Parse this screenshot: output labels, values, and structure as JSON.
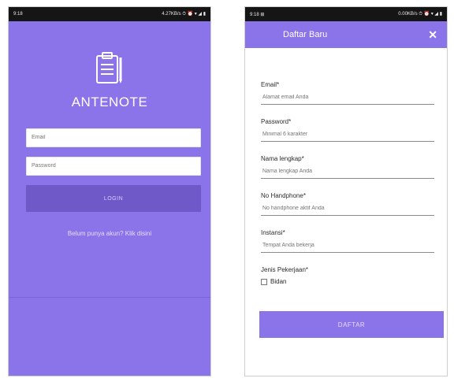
{
  "login_screen": {
    "status": {
      "time": "9:18",
      "info": "4.27KB/s ⏱ ⏰ ▾ ◢ ▮"
    },
    "app_title": "ANTENOTE",
    "email_placeholder": "Email",
    "password_placeholder": "Password",
    "login_label": "LOGIN",
    "register_link": "Belum punya akun? Klik disini",
    "accent": "#8b73ea",
    "button_color": "#6f58c8"
  },
  "register_screen": {
    "status": {
      "time": "9:18 ⊞",
      "info": "0.00KB/s ⏱ ⏰ ▾ ◢ ▮"
    },
    "title": "Daftar Baru",
    "close_icon": "close-icon",
    "fields": [
      {
        "label": "Email*",
        "placeholder": "Alamat email Anda"
      },
      {
        "label": "Password*",
        "placeholder": "Minimal 6 karakter"
      },
      {
        "label": "Nama lengkap*",
        "placeholder": "Nama lengkap Anda"
      },
      {
        "label": "No Handphone*",
        "placeholder": "No handphone aktif Anda"
      },
      {
        "label": "Instansi*",
        "placeholder": "Tempat Anda bekerja"
      }
    ],
    "jenis_label": "Jenis Pekerjaan*",
    "checkbox_label": "Bidan",
    "submit_label": "DAFTAR",
    "accent": "#8b73ea"
  }
}
